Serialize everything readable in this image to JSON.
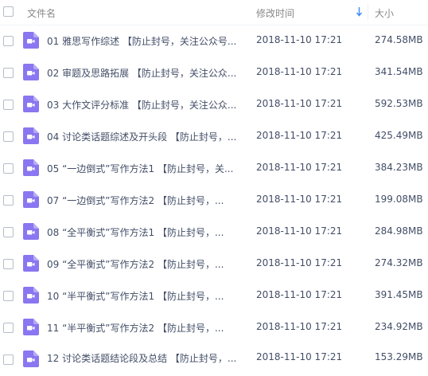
{
  "header": {
    "name_label": "文件名",
    "date_label": "修改时间",
    "size_label": "大小",
    "sort_icon": "arrow-down-icon"
  },
  "colors": {
    "file_icon": "#8a76f0",
    "sort_arrow": "#3b8cf5",
    "text": "#424e67",
    "header_text": "#888888"
  },
  "file_icon": "video-file-icon",
  "files": [
    {
      "name": "01 雅思写作综述 【防止封号，关注公众号...",
      "date": "2018-11-10 17:21",
      "size": "274.58MB"
    },
    {
      "name": "02 审题及思路拓展 【防止封号，关注公众...",
      "date": "2018-11-10 17:21",
      "size": "341.54MB"
    },
    {
      "name": "03 大作文评分标准 【防止封号，关注公众...",
      "date": "2018-11-10 17:21",
      "size": "592.53MB"
    },
    {
      "name": "04 讨论类话题综述及开头段 【防止封号，...",
      "date": "2018-11-10 17:21",
      "size": "425.49MB"
    },
    {
      "name": "05 “一边倒式”写作方法1 【防止封号，关...",
      "date": "2018-11-10 17:21",
      "size": "384.23MB"
    },
    {
      "name": "07 “一边倒式”写作方法2 【防止封号，...",
      "date": "2018-11-10 17:21",
      "size": "199.08MB"
    },
    {
      "name": "08 “全平衡式”写作方法1 【防止封号，...",
      "date": "2018-11-10 17:21",
      "size": "284.98MB"
    },
    {
      "name": "09 “全平衡式”写作方法2 【防止封号，...",
      "date": "2018-11-10 17:21",
      "size": "274.32MB"
    },
    {
      "name": "10 “半平衡式”写作方法1 【防止封号，...",
      "date": "2018-11-10 17:21",
      "size": "391.45MB"
    },
    {
      "name": "11 “半平衡式”写作方法2 【防止封号，...",
      "date": "2018-11-10 17:21",
      "size": "234.92MB"
    },
    {
      "name": "12 讨论类话题结论段及总结 【防止封号，...",
      "date": "2018-11-10 17:21",
      "size": "153.29MB"
    }
  ]
}
